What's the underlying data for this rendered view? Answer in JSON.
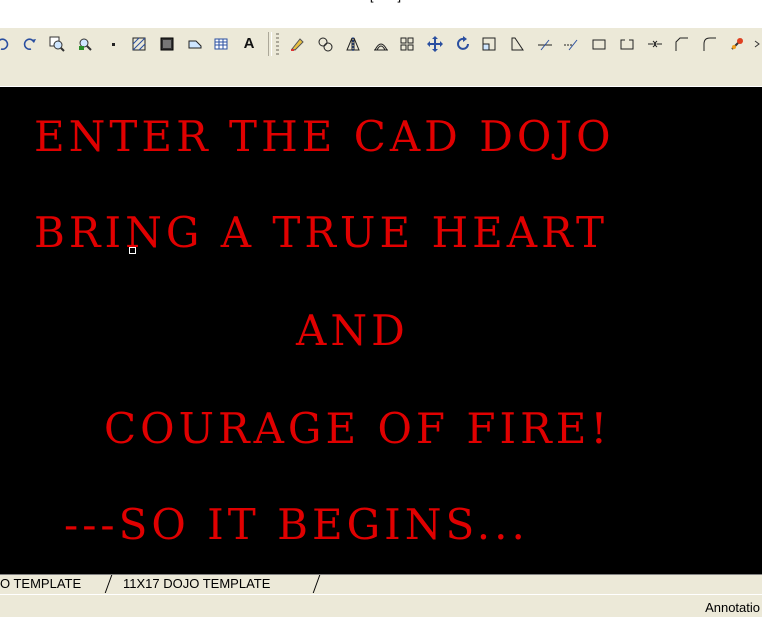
{
  "window": {
    "title_fragment": "- [ ... ]"
  },
  "toolbar": {
    "icons": [
      "undo-icon",
      "redo-icon",
      "zoom-window-icon",
      "zoom-previous-icon",
      "point-icon",
      "hatch-icon",
      "gradient-icon",
      "region-icon",
      "table-icon",
      "text-icon",
      "erase-icon",
      "copy-icon",
      "mirror-icon",
      "offset-icon",
      "array-icon",
      "move-icon",
      "rotate-icon",
      "scale-icon",
      "stretch-icon",
      "trim-icon",
      "extend-icon",
      "break-at-point-icon",
      "break-icon",
      "join-icon",
      "chamfer-icon",
      "fillet-icon",
      "explode-icon"
    ],
    "text_tool_label": "A"
  },
  "drawing": {
    "lines": [
      "ENTER THE CAD DOJO",
      "BRING A TRUE HEART",
      "AND",
      "COURAGE OF FIRE!",
      "---SO IT BEGINS..."
    ],
    "text_color": "#e00000",
    "background_color": "#000000"
  },
  "layout_tabs": [
    "O TEMPLATE",
    "11X17 DOJO TEMPLATE"
  ],
  "status_bar": {
    "annotation_label": "Annotatio"
  }
}
